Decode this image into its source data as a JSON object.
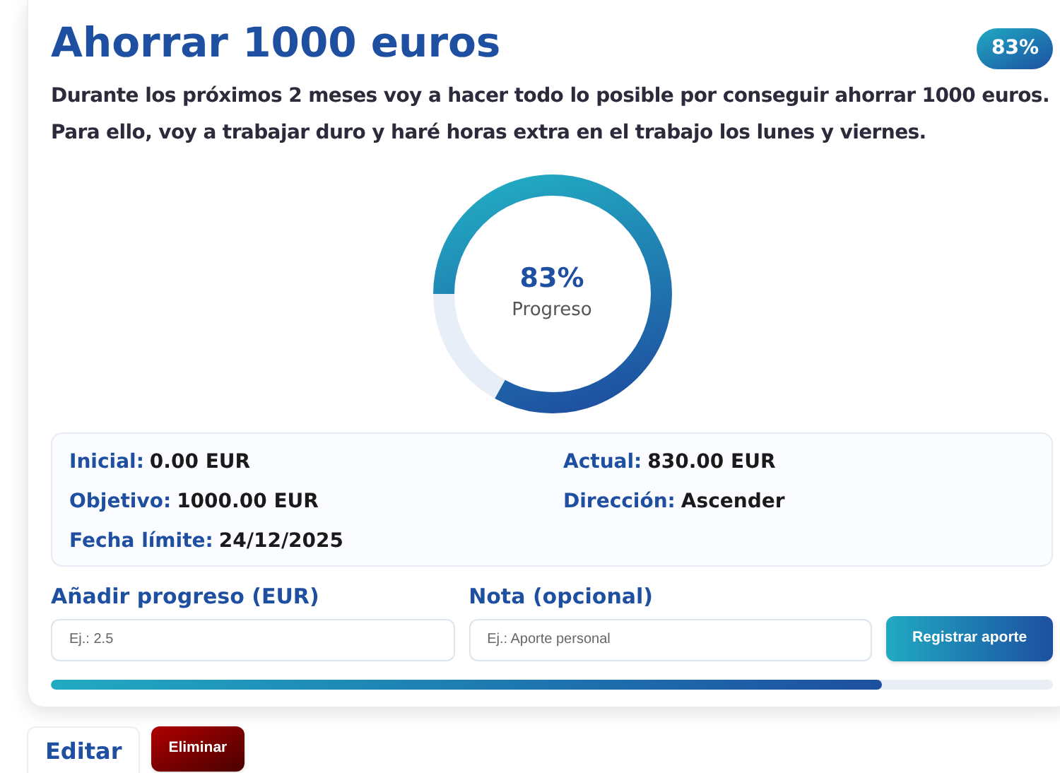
{
  "goal": {
    "title": "Ahorrar 1000 euros",
    "badge": "83%",
    "description": "Durante los próximos 2 meses voy a hacer todo lo posible por conseguir ahorrar 1000 euros. Para ello, voy a trabajar duro y haré horas extra en el trabajo los lunes y viernes."
  },
  "donut": {
    "level": 0.83,
    "reading": "83%",
    "label": "Progreso"
  },
  "details": [
    {
      "label": "Inicial:",
      "value": "0.00 EUR"
    },
    {
      "label": "Actual:",
      "value": "830.00 EUR"
    },
    {
      "label": "Objetivo:",
      "value": "1000.00 EUR"
    },
    {
      "label": "Dirección:",
      "value": "Ascender"
    },
    {
      "label": "Fecha límite:",
      "value": "24/12/2025"
    }
  ],
  "form": {
    "fields": [
      {
        "label": "Añadir progreso (EUR)",
        "placeholder": "Ej.: 2.5"
      },
      {
        "label": "Nota (opcional)",
        "placeholder": "Ej.: Aporte personal"
      }
    ],
    "submit": "Registrar aporte"
  },
  "progress_bar": {
    "level": 0.83
  },
  "actions": [
    {
      "label": "Editar",
      "kind": "edit"
    },
    {
      "label": "Eliminar",
      "kind": "delete"
    }
  ]
}
